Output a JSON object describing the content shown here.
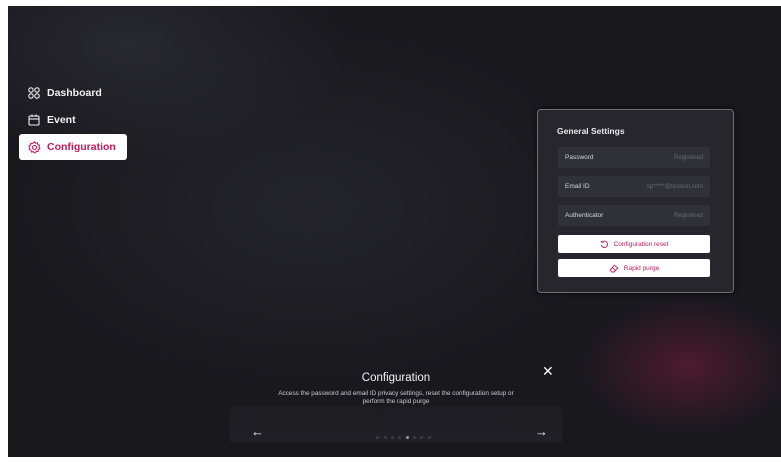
{
  "sidebar": {
    "items": [
      {
        "label": "Dashboard",
        "icon": "dashboard-icon",
        "active": false
      },
      {
        "label": "Event",
        "icon": "calendar-icon",
        "active": false
      },
      {
        "label": "Configuration",
        "icon": "gear-icon",
        "active": true
      }
    ]
  },
  "panel": {
    "title": "General Settings",
    "rows": [
      {
        "label": "Password",
        "value": "Registered"
      },
      {
        "label": "Email ID",
        "value": "sp*****@fession.com"
      },
      {
        "label": "Authenticator",
        "value": "Registered"
      }
    ],
    "reset_button": "Configuration reset",
    "purge_button": "Rapid purge"
  },
  "tooltip": {
    "title": "Configuration",
    "description": "Access the password and email ID privacy settings, reset the configuration setup or perform the rapid purge",
    "close_icon": "close-icon",
    "prev_icon": "arrow-left-icon",
    "next_icon": "arrow-right-icon",
    "step": 5,
    "total_steps": 8
  },
  "colors": {
    "accent": "#c2185b",
    "background": "#18181d",
    "panel": "#26262c"
  }
}
